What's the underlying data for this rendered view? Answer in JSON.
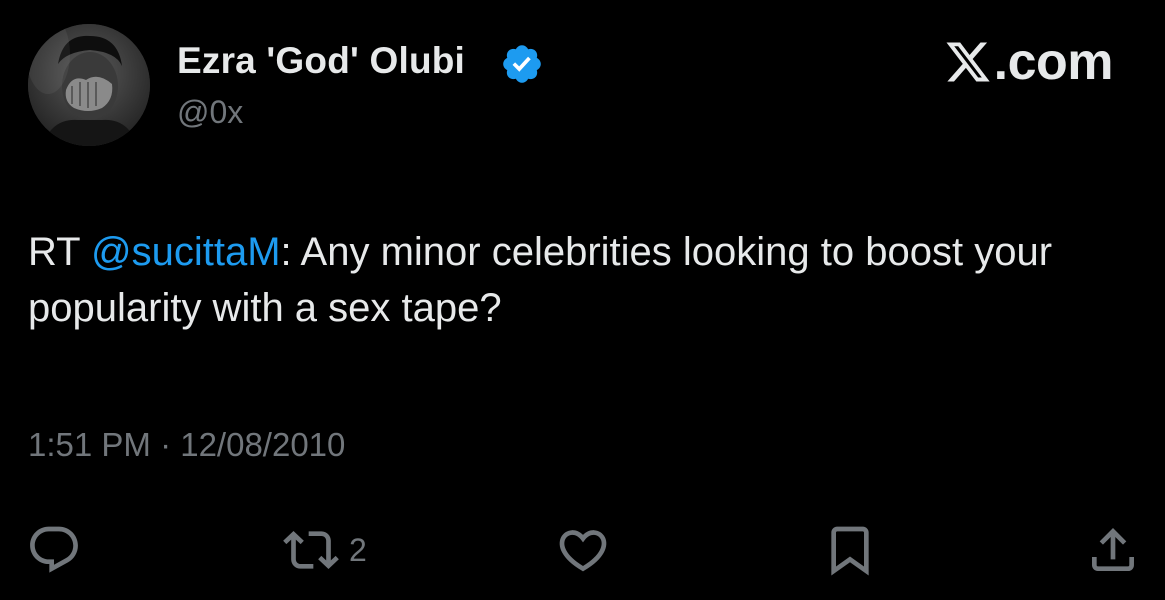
{
  "author": {
    "display_name": "Ezra 'God' Olubi",
    "handle": "@0x",
    "verified": true
  },
  "brand": {
    "text": ".com"
  },
  "tweet": {
    "prefix": "RT ",
    "mention": "@sucittaM",
    "body": ": Any minor celebrities looking to boost your popularity with a sex tape?",
    "timestamp": "1:51 PM · 12/08/2010"
  },
  "actions": {
    "reply_count": "",
    "retweet_count": "2",
    "like_count": "",
    "bookmark_count": ""
  },
  "colors": {
    "background": "#000000",
    "text": "#e7e9ea",
    "secondary": "#71767b",
    "accent": "#1d9bf0"
  },
  "icons": {
    "verified": "verified-badge-icon",
    "brand": "x-logo-icon",
    "reply": "speech-bubble-icon",
    "retweet": "retweet-arrows-icon",
    "like": "heart-icon",
    "bookmark": "bookmark-icon",
    "share": "share-upload-icon"
  }
}
